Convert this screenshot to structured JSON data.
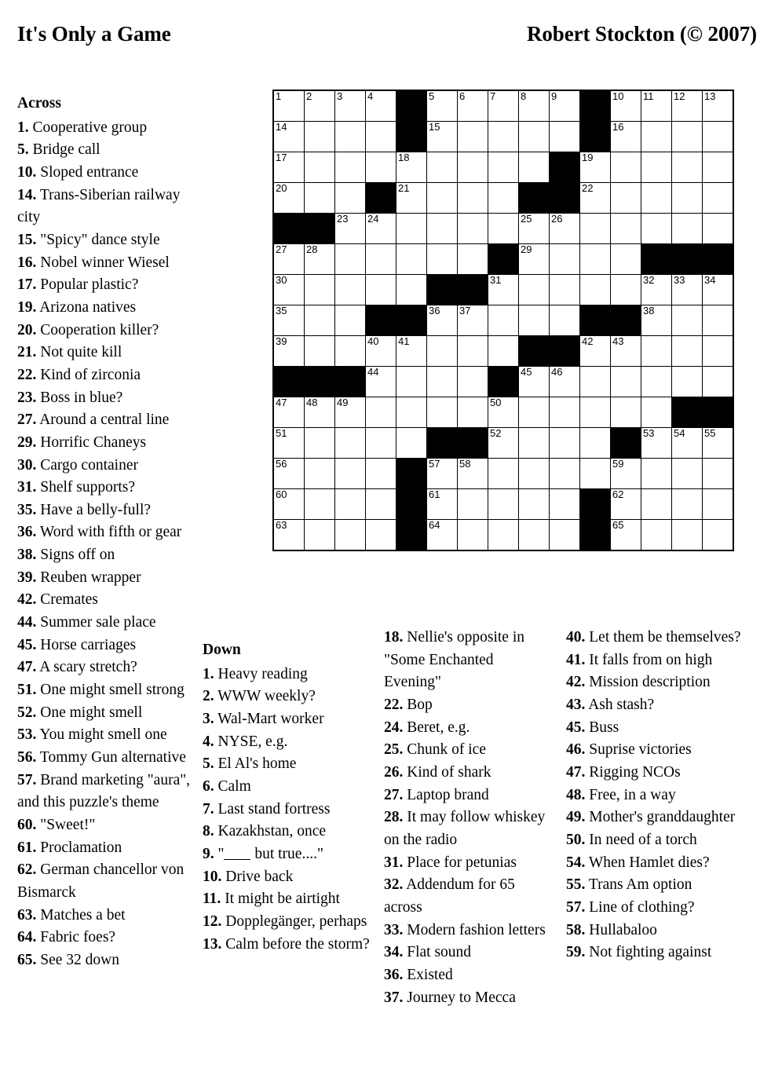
{
  "header": {
    "title": "It's Only a Game",
    "author": "Robert Stockton (© 2007)"
  },
  "labels": {
    "across_heading": "Across",
    "down_heading": "Down"
  },
  "grid": {
    "rows": 15,
    "cols": 15,
    "cell_colors": {
      "open": "#ffffff",
      "block": "#000000",
      "border": "#000000"
    },
    "pattern": [
      "....#.....#....",
      "....#.....#....",
      "....................",
      "...#........#..",
      "##.............",
      ".......#....###",
      ".....##........",
      "...##...###...."
    ],
    "matrix": [
      [
        1,
        1,
        1,
        1,
        0,
        1,
        1,
        1,
        1,
        1,
        0,
        1,
        1,
        1,
        1
      ],
      [
        1,
        1,
        1,
        1,
        0,
        1,
        1,
        1,
        1,
        1,
        0,
        1,
        1,
        1,
        1
      ],
      [
        1,
        1,
        1,
        1,
        1,
        1,
        1,
        1,
        1,
        0,
        1,
        1,
        1,
        1,
        1
      ],
      [
        1,
        1,
        1,
        0,
        1,
        1,
        1,
        1,
        0,
        0,
        1,
        1,
        1,
        1,
        1
      ],
      [
        0,
        0,
        1,
        1,
        1,
        1,
        1,
        1,
        1,
        1,
        1,
        1,
        1,
        1,
        1
      ],
      [
        1,
        1,
        1,
        1,
        1,
        1,
        1,
        0,
        1,
        1,
        1,
        1,
        0,
        0,
        0
      ],
      [
        1,
        1,
        1,
        1,
        1,
        0,
        0,
        1,
        1,
        1,
        1,
        1,
        1,
        1,
        1
      ],
      [
        1,
        1,
        1,
        0,
        0,
        1,
        1,
        1,
        1,
        1,
        0,
        0,
        1,
        1,
        1
      ],
      [
        1,
        1,
        1,
        1,
        1,
        1,
        1,
        1,
        0,
        0,
        1,
        1,
        1,
        1,
        1
      ],
      [
        0,
        0,
        0,
        1,
        1,
        1,
        1,
        0,
        1,
        1,
        1,
        1,
        1,
        1,
        1
      ],
      [
        1,
        1,
        1,
        1,
        1,
        1,
        1,
        1,
        1,
        1,
        1,
        1,
        1,
        0,
        0
      ],
      [
        1,
        1,
        1,
        1,
        1,
        0,
        0,
        1,
        1,
        1,
        1,
        0,
        1,
        1,
        1
      ],
      [
        1,
        1,
        1,
        1,
        0,
        1,
        1,
        1,
        1,
        1,
        1,
        1,
        1,
        1,
        1
      ],
      [
        1,
        1,
        1,
        1,
        0,
        1,
        1,
        1,
        1,
        1,
        0,
        1,
        1,
        1,
        1
      ],
      [
        1,
        1,
        1,
        1,
        0,
        1,
        1,
        1,
        1,
        1,
        0,
        1,
        1,
        1,
        1
      ]
    ],
    "numbers": [
      [
        1,
        2,
        3,
        4,
        0,
        5,
        6,
        7,
        8,
        9,
        0,
        10,
        11,
        12,
        13
      ],
      [
        14,
        0,
        0,
        0,
        0,
        15,
        0,
        0,
        0,
        0,
        0,
        16,
        0,
        0,
        0
      ],
      [
        17,
        0,
        0,
        0,
        18,
        0,
        0,
        0,
        0,
        0,
        19,
        0,
        0,
        0,
        0
      ],
      [
        20,
        0,
        0,
        0,
        21,
        0,
        0,
        0,
        0,
        0,
        22,
        0,
        0,
        0,
        0
      ],
      [
        0,
        0,
        23,
        24,
        0,
        0,
        0,
        0,
        25,
        26,
        0,
        0,
        0,
        0,
        0
      ],
      [
        27,
        28,
        0,
        0,
        0,
        0,
        0,
        0,
        29,
        0,
        0,
        0,
        0,
        0,
        0
      ],
      [
        30,
        0,
        0,
        0,
        0,
        0,
        0,
        31,
        0,
        0,
        0,
        0,
        32,
        33,
        34
      ],
      [
        35,
        0,
        0,
        0,
        0,
        36,
        37,
        0,
        0,
        0,
        0,
        0,
        38,
        0,
        0
      ],
      [
        39,
        0,
        0,
        40,
        41,
        0,
        0,
        0,
        0,
        0,
        42,
        43,
        0,
        0,
        0
      ],
      [
        0,
        0,
        0,
        44,
        0,
        0,
        0,
        0,
        45,
        46,
        0,
        0,
        0,
        0,
        0
      ],
      [
        47,
        48,
        49,
        0,
        0,
        0,
        0,
        50,
        0,
        0,
        0,
        0,
        0,
        0,
        0
      ],
      [
        51,
        0,
        0,
        0,
        0,
        0,
        0,
        52,
        0,
        0,
        0,
        0,
        53,
        54,
        55
      ],
      [
        56,
        0,
        0,
        0,
        0,
        57,
        58,
        0,
        0,
        0,
        0,
        59,
        0,
        0,
        0
      ],
      [
        60,
        0,
        0,
        0,
        0,
        61,
        0,
        0,
        0,
        0,
        0,
        62,
        0,
        0,
        0
      ],
      [
        63,
        0,
        0,
        0,
        0,
        64,
        0,
        0,
        0,
        0,
        0,
        65,
        0,
        0,
        0
      ]
    ]
  },
  "across": [
    {
      "num": "1.",
      "text": "Cooperative group"
    },
    {
      "num": "5.",
      "text": "Bridge call"
    },
    {
      "num": "10.",
      "text": "Sloped entrance"
    },
    {
      "num": "14.",
      "text": "Trans-Siberian railway city"
    },
    {
      "num": "15.",
      "text": "\"Spicy\" dance style"
    },
    {
      "num": "16.",
      "text": "Nobel winner Wiesel"
    },
    {
      "num": "17.",
      "text": "Popular plastic?"
    },
    {
      "num": "19.",
      "text": "Arizona natives"
    },
    {
      "num": "20.",
      "text": "Cooperation killer?"
    },
    {
      "num": "21.",
      "text": "Not quite kill"
    },
    {
      "num": "22.",
      "text": "Kind of zirconia"
    },
    {
      "num": "23.",
      "text": "Boss in blue?"
    },
    {
      "num": "27.",
      "text": "Around a central line"
    },
    {
      "num": "29.",
      "text": "Horrific Chaneys"
    },
    {
      "num": "30.",
      "text": "Cargo container"
    },
    {
      "num": "31.",
      "text": "Shelf supports?"
    },
    {
      "num": "35.",
      "text": "Have a belly-full?"
    },
    {
      "num": "36.",
      "text": "Word with fifth or gear"
    },
    {
      "num": "38.",
      "text": "Signs off on"
    },
    {
      "num": "39.",
      "text": "Reuben wrapper"
    },
    {
      "num": "42.",
      "text": "Cremates"
    },
    {
      "num": "44.",
      "text": "Summer sale place"
    },
    {
      "num": "45.",
      "text": "Horse carriages"
    },
    {
      "num": "47.",
      "text": "A scary stretch?"
    },
    {
      "num": "51.",
      "text": "One might smell strong"
    },
    {
      "num": "52.",
      "text": "One might smell"
    },
    {
      "num": "53.",
      "text": "You might smell one"
    },
    {
      "num": "56.",
      "text": "Tommy Gun alternative"
    },
    {
      "num": "57.",
      "text": "Brand marketing \"aura\", and this puzzle's theme"
    },
    {
      "num": "60.",
      "text": "\"Sweet!\""
    },
    {
      "num": "61.",
      "text": "Proclamation"
    },
    {
      "num": "62.",
      "text": "German chancellor von Bismarck"
    },
    {
      "num": "63.",
      "text": "Matches a bet"
    },
    {
      "num": "64.",
      "text": "Fabric foes?"
    },
    {
      "num": "65.",
      "text": "See 32 down"
    }
  ],
  "down_col1": [
    {
      "num": "1.",
      "text": "Heavy reading"
    },
    {
      "num": "2.",
      "text": "WWW weekly?"
    },
    {
      "num": "3.",
      "text": "Wal-Mart worker"
    },
    {
      "num": "4.",
      "text": "NYSE, e.g."
    },
    {
      "num": "5.",
      "text": "El Al's home"
    },
    {
      "num": "6.",
      "text": "Calm"
    },
    {
      "num": "7.",
      "text": "Last stand fortress"
    },
    {
      "num": "8.",
      "text": "Kazakhstan, once"
    },
    {
      "num": "9.",
      "text": "\"___ but true....\"",
      "has_blank": true,
      "before": "\"",
      "after": " but true....\""
    },
    {
      "num": "10.",
      "text": "Drive back"
    },
    {
      "num": "11.",
      "text": "It might be airtight"
    },
    {
      "num": "12.",
      "text": "Dopplegänger, perhaps"
    },
    {
      "num": "13.",
      "text": "Calm before the storm?"
    }
  ],
  "down_col2": [
    {
      "num": "18.",
      "text": "Nellie's opposite in \"Some Enchanted Evening\""
    },
    {
      "num": "22.",
      "text": "Bop"
    },
    {
      "num": "24.",
      "text": "Beret, e.g."
    },
    {
      "num": "25.",
      "text": "Chunk of ice"
    },
    {
      "num": "26.",
      "text": "Kind of shark"
    },
    {
      "num": "27.",
      "text": "Laptop brand"
    },
    {
      "num": "28.",
      "text": "It may follow whiskey on the radio"
    },
    {
      "num": "31.",
      "text": "Place for petunias"
    },
    {
      "num": "32.",
      "text": "Addendum for 65 across"
    },
    {
      "num": "33.",
      "text": "Modern fashion letters"
    },
    {
      "num": "34.",
      "text": "Flat sound"
    },
    {
      "num": "36.",
      "text": "Existed"
    },
    {
      "num": "37.",
      "text": "Journey to Mecca"
    }
  ],
  "down_col3": [
    {
      "num": "40.",
      "text": "Let them be themselves?"
    },
    {
      "num": "41.",
      "text": "It falls from on high"
    },
    {
      "num": "42.",
      "text": "Mission description"
    },
    {
      "num": "43.",
      "text": "Ash stash?"
    },
    {
      "num": "45.",
      "text": "Buss"
    },
    {
      "num": "46.",
      "text": "Suprise victories"
    },
    {
      "num": "47.",
      "text": "Rigging NCOs"
    },
    {
      "num": "48.",
      "text": "Free, in a way"
    },
    {
      "num": "49.",
      "text": "Mother's granddaughter"
    },
    {
      "num": "50.",
      "text": "In need of a torch"
    },
    {
      "num": "54.",
      "text": "When Hamlet dies?"
    },
    {
      "num": "55.",
      "text": "Trans Am option"
    },
    {
      "num": "57.",
      "text": "Line of clothing?"
    },
    {
      "num": "58.",
      "text": "Hullabaloo"
    },
    {
      "num": "59.",
      "text": "Not fighting against"
    }
  ]
}
